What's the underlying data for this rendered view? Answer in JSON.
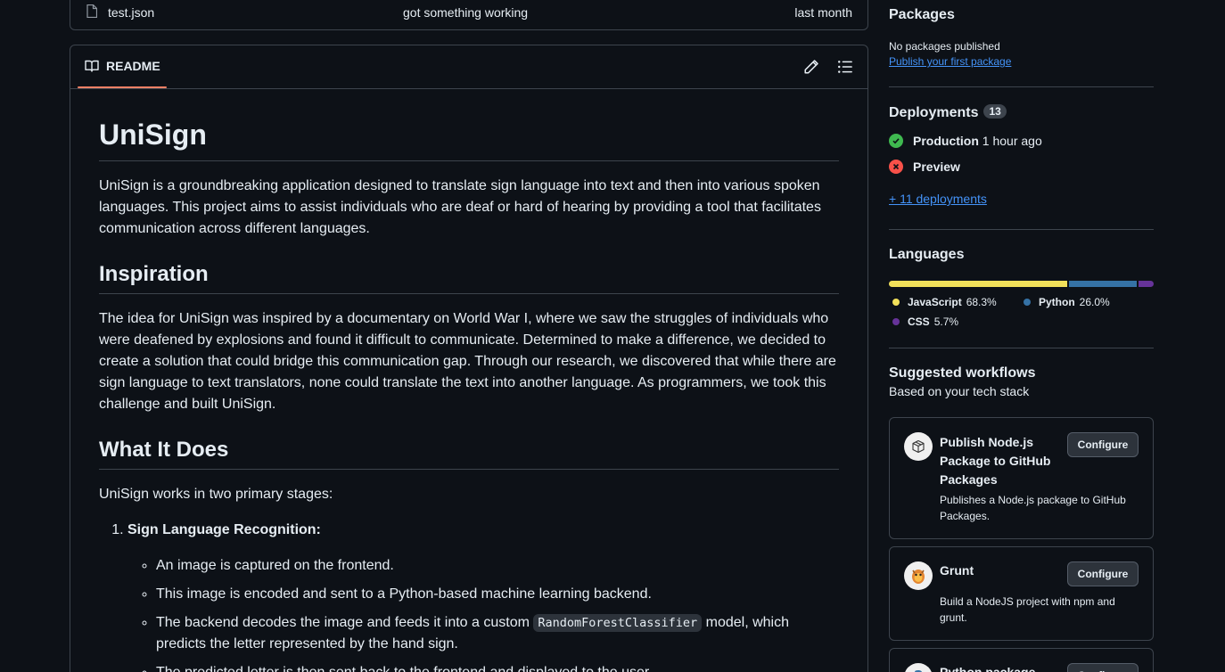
{
  "file_row": {
    "name": "test.json",
    "message": "got something working",
    "date": "last month"
  },
  "readme": {
    "tab_label": "README",
    "title": "UniSign",
    "intro": "UniSign is a groundbreaking application designed to translate sign language into text and then into various spoken languages. This project aims to assist individuals who are deaf or hard of hearing by providing a tool that facilitates communication across different languages.",
    "h_inspiration": "Inspiration",
    "inspiration": "The idea for UniSign was inspired by a documentary on World War I, where we saw the struggles of individuals who were deafened by explosions and found it difficult to communicate. Determined to make a difference, we decided to create a solution that could bridge this communication gap. Through our research, we discovered that while there are sign language to text translators, none could translate the text into another language. As programmers, we took this challenge and built UniSign.",
    "h_what": "What It Does",
    "what_intro": "UniSign works in two primary stages:",
    "stage1_title": "Sign Language Recognition:",
    "stage1_items": [
      "An image is captured on the frontend.",
      "This image is encoded and sent to a Python-based machine learning backend.",
      "The backend decodes the image and feeds it into a custom ",
      "The predicted letter is then sent back to the frontend and displayed to the user."
    ],
    "code_token": "RandomForestClassifier",
    "stage1_item3_tail": " model, which predicts the letter represented by the hand sign."
  },
  "sidebar": {
    "packages": {
      "heading": "Packages",
      "none": "No packages published",
      "link": "Publish your first package"
    },
    "deployments": {
      "heading": "Deployments",
      "count": "13",
      "items": [
        {
          "name": "Production",
          "time": "1 hour ago",
          "status": "success"
        },
        {
          "name": "Preview",
          "time": "",
          "status": "failure"
        }
      ],
      "more": "+ 11 deployments"
    },
    "languages": {
      "heading": "Languages",
      "items": [
        {
          "name": "JavaScript",
          "percent": "68.3%",
          "share": 68.3,
          "color": "#f1e05a"
        },
        {
          "name": "Python",
          "percent": "26.0%",
          "share": 26.0,
          "color": "#3572A5"
        },
        {
          "name": "CSS",
          "percent": "5.7%",
          "share": 5.7,
          "color": "#663399"
        }
      ]
    },
    "workflows": {
      "heading": "Suggested workflows",
      "subheading": "Based on your tech stack",
      "items": [
        {
          "title": "Publish Node.js Package to GitHub Packages",
          "desc": "Publishes a Node.js package to GitHub Packages.",
          "button": "Configure",
          "icon": "package-icon"
        },
        {
          "title": "Grunt",
          "desc": "Build a NodeJS project with npm and grunt.",
          "button": "Configure",
          "icon": "grunt-icon"
        },
        {
          "title": "Python package",
          "desc": "",
          "button": "Configure",
          "icon": "python-icon"
        }
      ]
    }
  }
}
